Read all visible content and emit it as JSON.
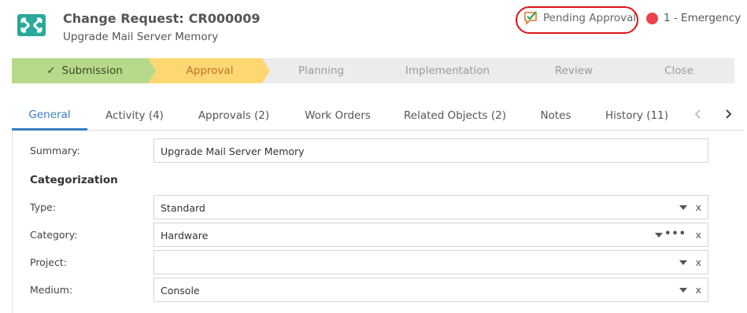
{
  "header": {
    "title_prefix": "Change Request:",
    "number": "CR000009",
    "subtitle": "Upgrade Mail Server Memory",
    "status_label": "Pending Approval",
    "priority_label": "1 - Emergency",
    "status_highlight_color": "#e0101a",
    "priority_color": "#ee3f4d",
    "logo_icon": "change-request-icon"
  },
  "stages": [
    {
      "label": "Submission",
      "state": "done",
      "color": "#b7d98b"
    },
    {
      "label": "Approval",
      "state": "current",
      "color": "#fdd872"
    },
    {
      "label": "Planning",
      "state": "pending",
      "color": "#ececec"
    },
    {
      "label": "Implementation",
      "state": "pending",
      "color": "#ececec"
    },
    {
      "label": "Review",
      "state": "pending",
      "color": "#ececec"
    },
    {
      "label": "Close",
      "state": "pending",
      "color": "#ececec"
    }
  ],
  "tabs": [
    {
      "label": "General",
      "active": true
    },
    {
      "label": "Activity (4)"
    },
    {
      "label": "Approvals (2)"
    },
    {
      "label": "Work Orders"
    },
    {
      "label": "Related Objects (2)"
    },
    {
      "label": "Notes"
    },
    {
      "label": "History (11)"
    }
  ],
  "form": {
    "summary_label": "Summary:",
    "summary_value": "Upgrade Mail Server Memory",
    "section_title": "Categorization",
    "type_label": "Type:",
    "type_value": "Standard",
    "category_label": "Category:",
    "category_value": "Hardware",
    "project_label": "Project:",
    "project_value": "",
    "medium_label": "Medium:",
    "medium_value": "Console",
    "clear_glyph": "x",
    "more_glyph": "•••"
  }
}
